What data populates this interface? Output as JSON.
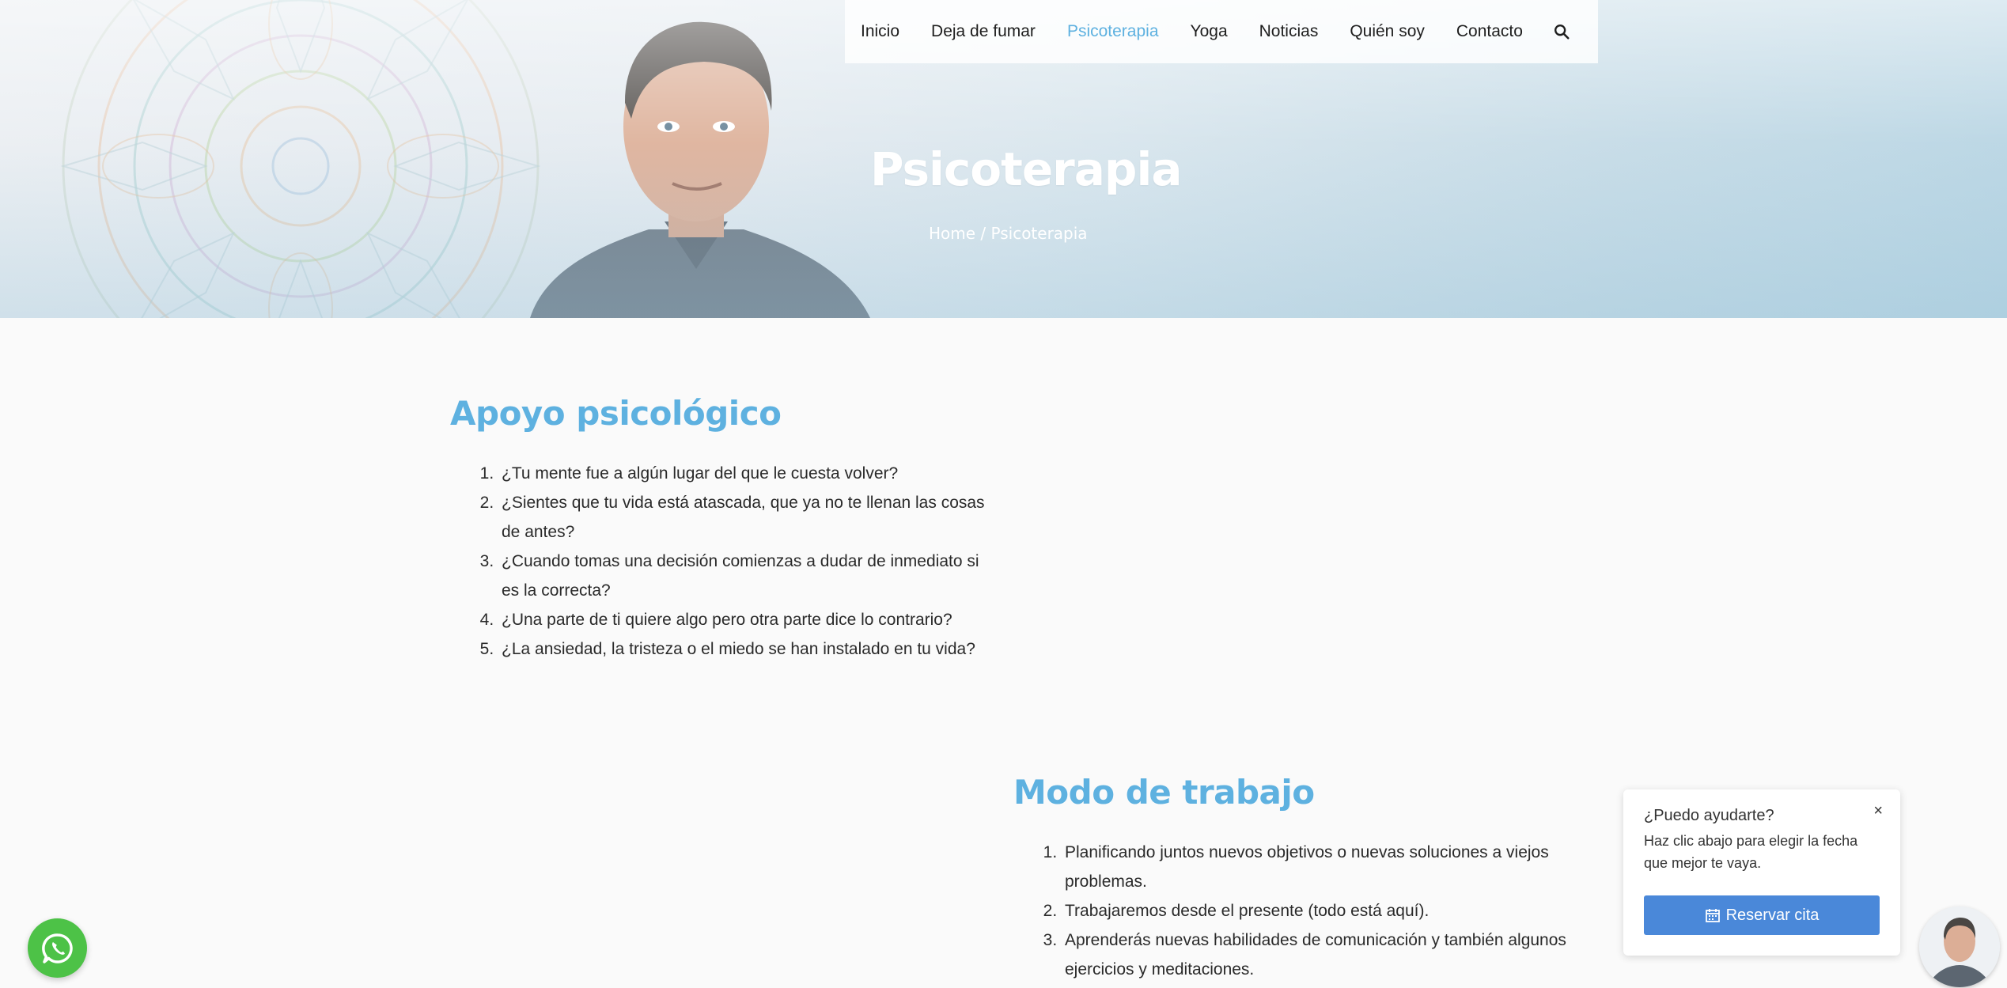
{
  "nav": {
    "items": [
      {
        "label": "Inicio"
      },
      {
        "label": "Deja de fumar"
      },
      {
        "label": "Psicoterapia"
      },
      {
        "label": "Yoga"
      },
      {
        "label": "Noticias"
      },
      {
        "label": "Quién soy"
      },
      {
        "label": "Contacto"
      }
    ],
    "active": "Psicoterapia",
    "search_icon": "search-icon"
  },
  "hero": {
    "title": "Psicoterapia",
    "breadcrumb": "Home / Psicoterapia"
  },
  "apoyo": {
    "title": "Apoyo psicológico",
    "items": [
      "¿Tu mente fue a algún lugar del que le cuesta volver?",
      "¿Sientes que tu vida está atascada, que ya no te llenan las cosas de antes?",
      "¿Cuando tomas una decisión comienzas a dudar de inmediato si es la correcta?",
      "¿Una parte de ti quiere algo pero otra parte dice lo contrario?",
      "¿La ansiedad, la tristeza o el miedo se han instalado en tu vida?"
    ]
  },
  "modo": {
    "title": "Modo de trabajo",
    "items": [
      "Planificando juntos nuevos objetivos o nuevas soluciones a viejos problemas.",
      "Trabajaremos desde el presente (todo está  aquí).",
      "Aprenderás nuevas habilidades de comunicación y también algunos ejercicios y meditaciones."
    ]
  },
  "chat": {
    "title": "¿Puedo ayudarte?",
    "text": "Haz clic abajo para elegir la fecha que mejor te vaya.",
    "button": "Reservar cita",
    "close": "×"
  },
  "colors": {
    "accent": "#5eb1e0",
    "button": "#4a88d9",
    "whatsapp": "#4dc247"
  }
}
